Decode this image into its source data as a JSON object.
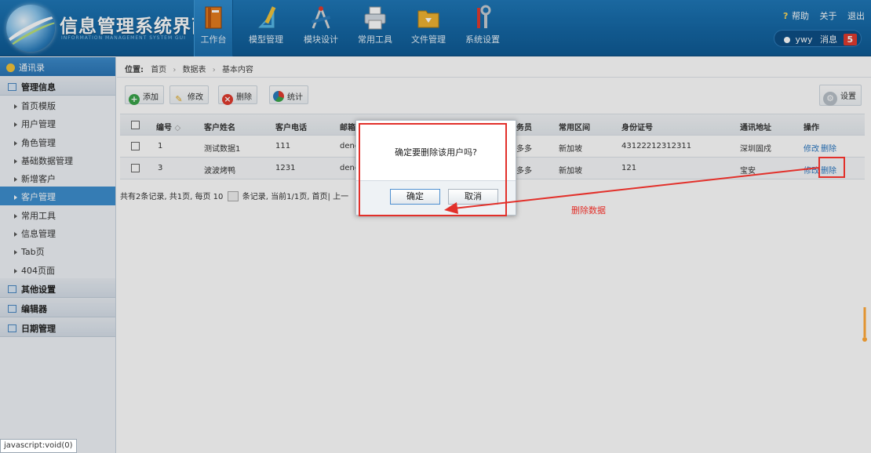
{
  "header": {
    "title": "信息管理系统界面",
    "subtitle": "INFORMATION MANAGEMENT SYSTEM GUI",
    "nav": [
      {
        "label": "工作台",
        "icon": "book-icon"
      },
      {
        "label": "模型管理",
        "icon": "ruler-icon"
      },
      {
        "label": "模块设计",
        "icon": "compass-icon"
      },
      {
        "label": "常用工具",
        "icon": "printer-icon"
      },
      {
        "label": "文件管理",
        "icon": "folder-icon"
      },
      {
        "label": "系统设置",
        "icon": "tools-icon"
      }
    ],
    "help": "帮助",
    "about": "关于",
    "logout": "退出",
    "username": "ywy",
    "messages_label": "消息",
    "messages_count": "5"
  },
  "sidebar": {
    "top": "通讯录",
    "group_main": "管理信息",
    "items": [
      "首页模版",
      "用户管理",
      "角色管理",
      "基础数据管理",
      "新增客户",
      "客户管理",
      "常用工具",
      "信息管理",
      "Tab页",
      "404页面"
    ],
    "group_other": "其他设置",
    "group_editor": "编辑器",
    "group_date": "日期管理"
  },
  "breadcrumb": {
    "label": "位置:",
    "items": [
      "首页",
      "数据表",
      "基本内容"
    ]
  },
  "toolbar": {
    "add": "添加",
    "edit": "修改",
    "delete": "删除",
    "stats": "统计",
    "settings": "设置"
  },
  "table": {
    "headers": [
      "编号",
      "客户姓名",
      "客户电话",
      "邮箱",
      "务员",
      "常用区间",
      "身份证号",
      "通讯地址",
      "操作"
    ],
    "rows": [
      {
        "id": "1",
        "name": "测试数据1",
        "phone": "111",
        "email": "denc",
        "agent": "多多",
        "region": "新加坡",
        "idcard": "43122212312311",
        "address": "深圳固戍",
        "edit": "修改",
        "delete": "删除"
      },
      {
        "id": "3",
        "name": "波波烤鸭",
        "phone": "1231",
        "email": "denc",
        "agent": "多多",
        "region": "新加坡",
        "idcard": "121",
        "address": "宝安",
        "edit": "修改",
        "delete": "删除"
      }
    ]
  },
  "pager": {
    "text_a": "共有2条记录, 共1页, 每页",
    "page_size": "10",
    "text_b": "条记录, 当前1/1页, 首页| 上一"
  },
  "dialog": {
    "message": "确定要删除该用户吗?",
    "ok": "确定",
    "cancel": "取消"
  },
  "annotation": {
    "label": "删除数据",
    "color": "#e2302a"
  },
  "status_bar": "javascript:void(0)"
}
